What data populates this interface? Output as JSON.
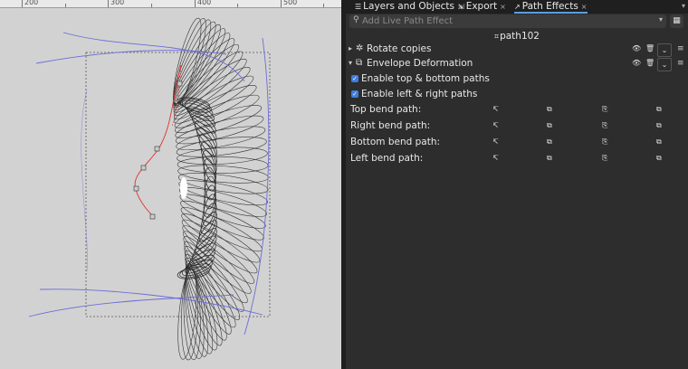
{
  "ruler": {
    "labels": [
      "200",
      "300",
      "400",
      "500"
    ]
  },
  "tabs": [
    {
      "label": "Layers and Objects",
      "icon": "layers-icon",
      "close": "×"
    },
    {
      "label": "Export",
      "icon": "export-icon",
      "close": "×"
    },
    {
      "label": "Path Effects",
      "icon": "path-effects-icon",
      "close": "×",
      "active": true
    }
  ],
  "search": {
    "placeholder": "Add Live Path Effect"
  },
  "path_name": "path102",
  "effects": [
    {
      "label": "Rotate copies",
      "icon": "rotate-copies-icon",
      "expanded": false
    },
    {
      "label": "Envelope Deformation",
      "icon": "envelope-icon",
      "expanded": true
    }
  ],
  "checkboxes": [
    {
      "label": "Enable top & bottom paths",
      "checked": true
    },
    {
      "label": "Enable left & right paths",
      "checked": true
    }
  ],
  "bend_paths": [
    {
      "label": "Top bend path:"
    },
    {
      "label": "Right bend path:"
    },
    {
      "label": "Bottom bend path:"
    },
    {
      "label": "Left bend path:"
    }
  ],
  "colors": {
    "accent": "#5a9dde",
    "checkbox": "#3d7ede",
    "canvas": "#d2d2d2",
    "panel": "#2d2d2d",
    "guide": "#6c6cd8",
    "handle_path": "#e03030"
  }
}
